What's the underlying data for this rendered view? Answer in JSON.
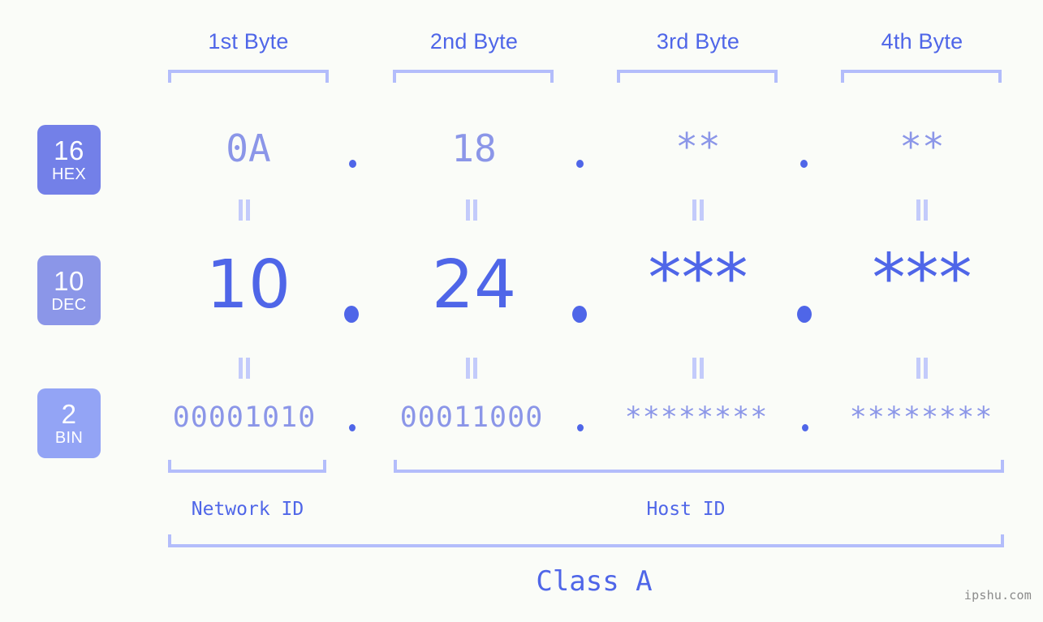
{
  "background_color": "#fafcf8",
  "accent_color": "#4f66e8",
  "muted_color": "#8b96e8",
  "bracket_color": "#b3bdfb",
  "byte_headers": [
    {
      "label": "1st Byte"
    },
    {
      "label": "2nd Byte"
    },
    {
      "label": "3rd Byte"
    },
    {
      "label": "4th Byte"
    }
  ],
  "radix_rows": [
    {
      "base": "16",
      "name": "HEX",
      "badge_color": "#7380e8"
    },
    {
      "base": "10",
      "name": "DEC",
      "badge_color": "#8b96e8"
    },
    {
      "base": "2",
      "name": "BIN",
      "badge_color": "#93a4f5"
    }
  ],
  "values": {
    "hex": [
      "0A",
      "18",
      "**",
      "**"
    ],
    "dec": [
      "10",
      "24",
      "***",
      "***"
    ],
    "bin": [
      "00001010",
      "00011000",
      "********",
      "********"
    ]
  },
  "separator_dot": ".",
  "equals_sign": "=",
  "groups": [
    {
      "label": "Network ID"
    },
    {
      "label": "Host ID"
    }
  ],
  "class_label": "Class A",
  "watermark": "ipshu.com"
}
